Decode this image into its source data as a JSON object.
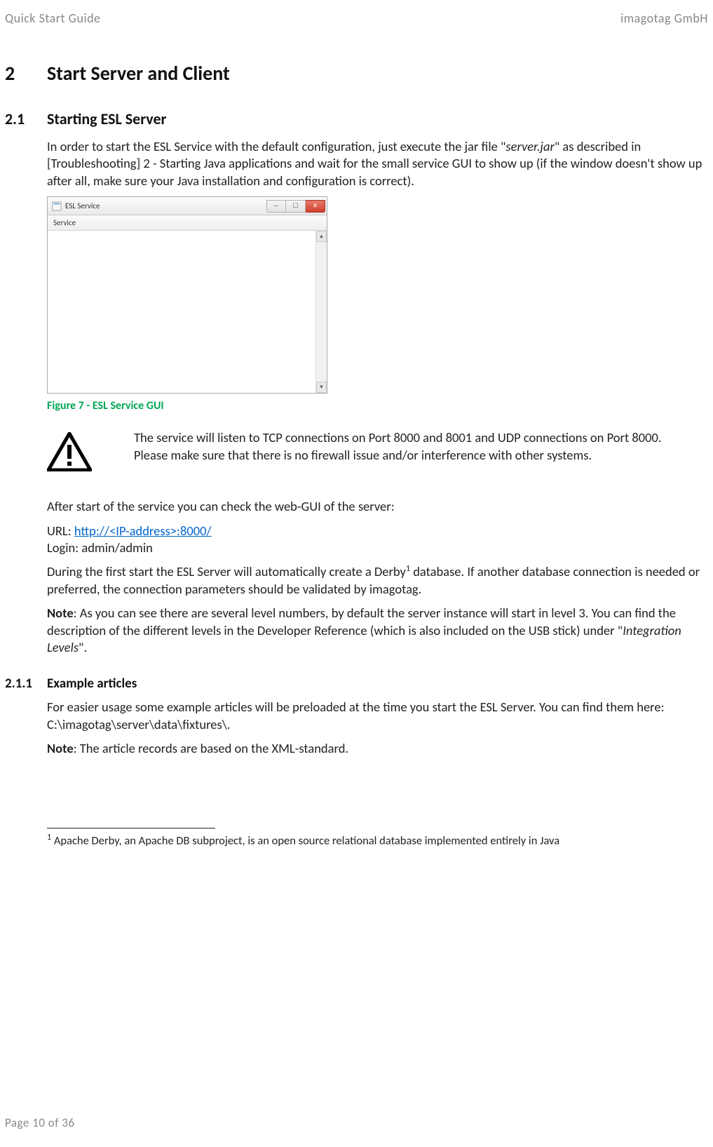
{
  "header": {
    "left": "Quick Start Guide",
    "right": "imagotag GmbH"
  },
  "section": {
    "num": "2",
    "title": "Start Server and Client"
  },
  "subsection": {
    "num": "2.1",
    "title": "Starting ESL Server"
  },
  "p1_a": "In order to start the ESL Service with the default configuration, just execute the jar file \"",
  "p1_b": "server.jar",
  "p1_c": "\" as described in [Troubleshooting] 2 - Starting Java applications and wait for the small service GUI to show up (if the window doesn't show up after all, make sure your Java installation and configuration is correct).",
  "esl_window": {
    "title": "ESL Service",
    "menu": "Service"
  },
  "figure_caption": "Figure 7 - ESL Service GUI",
  "warning": "The service will listen to TCP connections on Port 8000 and 8001 and UDP connections on Port 8000. Please make sure that there is no firewall issue and/or interference with other systems.",
  "p2": "After start of the service you can check the web-GUI of the server:",
  "url_label": "URL: ",
  "url_link": "http://<IP-address>:8000/",
  "login": "Login: admin/admin",
  "p3_a": "During the first start the ESL Server will automatically create a Derby",
  "p3_sup": "1",
  "p3_b": " database. If another database connection is needed or preferred, the connection parameters should be validated by imagotag.",
  "note1_label": "Note",
  "note1_a": ": As you can see there are several level numbers, by default the server instance will start in level 3. You can find the description of the different levels in the Developer Reference (which is also included on the USB stick) under \"",
  "note1_b": "Integration Levels",
  "note1_c": "\".",
  "subsub": {
    "num": "2.1.1",
    "title": "Example articles"
  },
  "p4": "For easier usage some example articles will be preloaded at the time you start the ESL Server. You can find them here:  C:\\imagotag\\server\\data\\fixtures\\.",
  "note2_label": "Note",
  "note2_text": ": The article records are based on the XML-standard.",
  "footnote_sup": "1",
  "footnote": " Apache Derby, an Apache DB subproject, is an open source relational database implemented entirely in Java",
  "footer": "Page 10 of 36"
}
